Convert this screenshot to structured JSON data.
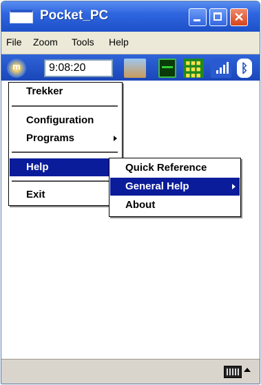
{
  "window": {
    "title": "Pocket_PC"
  },
  "menubar": {
    "items": [
      "File",
      "Zoom",
      "Tools",
      "Help"
    ]
  },
  "toolbar": {
    "clock": "9:08:20",
    "logo_icon": "m-logo-icon",
    "icons": [
      "globe-connect-icon",
      "battery-icon",
      "keypad-icon",
      "signal-icon",
      "bluetooth-icon"
    ]
  },
  "menu": {
    "items": [
      {
        "label": "Trekker"
      },
      {
        "label": "Configuration"
      },
      {
        "label": "Programs",
        "has_submenu": true
      },
      {
        "label": "Help",
        "selected": true,
        "has_submenu": true
      },
      {
        "label": "Exit"
      }
    ]
  },
  "submenu": {
    "items": [
      {
        "label": "Quick Reference"
      },
      {
        "label": "General Help",
        "selected": true,
        "has_submenu": true
      },
      {
        "label": "About"
      }
    ]
  },
  "colors": {
    "titlebar": "#2f66df",
    "selection": "#0a1c9a",
    "menubar": "#ece9d8"
  }
}
